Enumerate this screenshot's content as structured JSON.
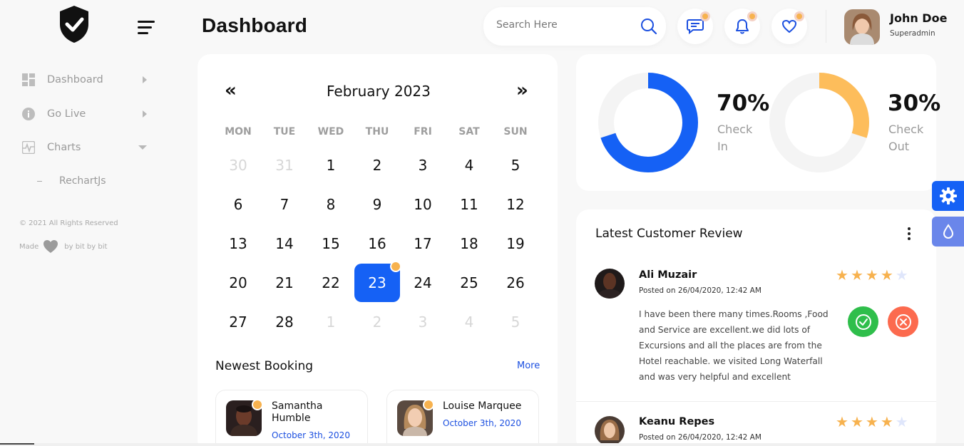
{
  "header": {
    "title": "Dashboard",
    "search_placeholder": "Search Here",
    "user_name": "John Doe",
    "user_role": "Superadmin"
  },
  "sidebar": {
    "items": [
      {
        "label": "Dashboard"
      },
      {
        "label": "Go Live"
      },
      {
        "label": "Charts"
      }
    ],
    "sub_items": [
      {
        "label": "RechartJs"
      }
    ],
    "copyright": "© 2021 All Rights Reserved",
    "made_prefix": "Made",
    "made_suffix": "by bit by bit"
  },
  "calendar": {
    "month_label": "February 2023",
    "prev_glyph": "«",
    "next_glyph": "»",
    "weekdays": [
      "MON",
      "TUE",
      "WED",
      "THU",
      "FRI",
      "SAT",
      "SUN"
    ],
    "weeks": [
      [
        "30",
        "31",
        "1",
        "2",
        "3",
        "4",
        "5"
      ],
      [
        "6",
        "7",
        "8",
        "9",
        "10",
        "11",
        "12"
      ],
      [
        "13",
        "14",
        "15",
        "16",
        "17",
        "18",
        "19"
      ],
      [
        "20",
        "21",
        "22",
        "23",
        "24",
        "25",
        "26"
      ],
      [
        "27",
        "28",
        "1",
        "2",
        "3",
        "4",
        "5"
      ]
    ],
    "selected_day": "23"
  },
  "newest_booking": {
    "title": "Newest Booking",
    "more_label": "More",
    "bookings": [
      {
        "name": "Samantha Humble",
        "date": "October 3th, 2020"
      },
      {
        "name": "Louise Marquee",
        "date": "October 3th, 2020"
      }
    ]
  },
  "check_stats": {
    "check_in": {
      "percent_label": "70%",
      "label_line1": "Check",
      "label_line2": "In",
      "value": 70,
      "color": "#1561f5"
    },
    "check_out": {
      "percent_label": "30%",
      "label_line1": "Check",
      "label_line2": "Out",
      "value": 30,
      "color": "#fdbd5b"
    }
  },
  "reviews": {
    "title": "Latest Customer Review",
    "items": [
      {
        "name": "Ali Muzair",
        "date": "Posted on 26/04/2020, 12:42 AM",
        "text": "I have been there many times.Rooms ,Food and Service are excellent.we did lots of Excursions and all the places are from the Hotel reachable. we visited Long Waterfall and was very helpful and excellent",
        "rating": 4
      },
      {
        "name": "Keanu Repes",
        "date": "Posted on 26/04/2020, 12:42 AM",
        "text": "",
        "rating": 4
      }
    ]
  },
  "colors": {
    "accent": "#1561f5",
    "star": "#f7b24f",
    "approve": "#2fbe4b",
    "reject": "#fc6a4e"
  },
  "icons": [
    "shield-check-logo",
    "menu-icon",
    "search-icon",
    "chat-icon",
    "bell-icon",
    "heart-icon",
    "gear-icon",
    "drop-icon"
  ]
}
